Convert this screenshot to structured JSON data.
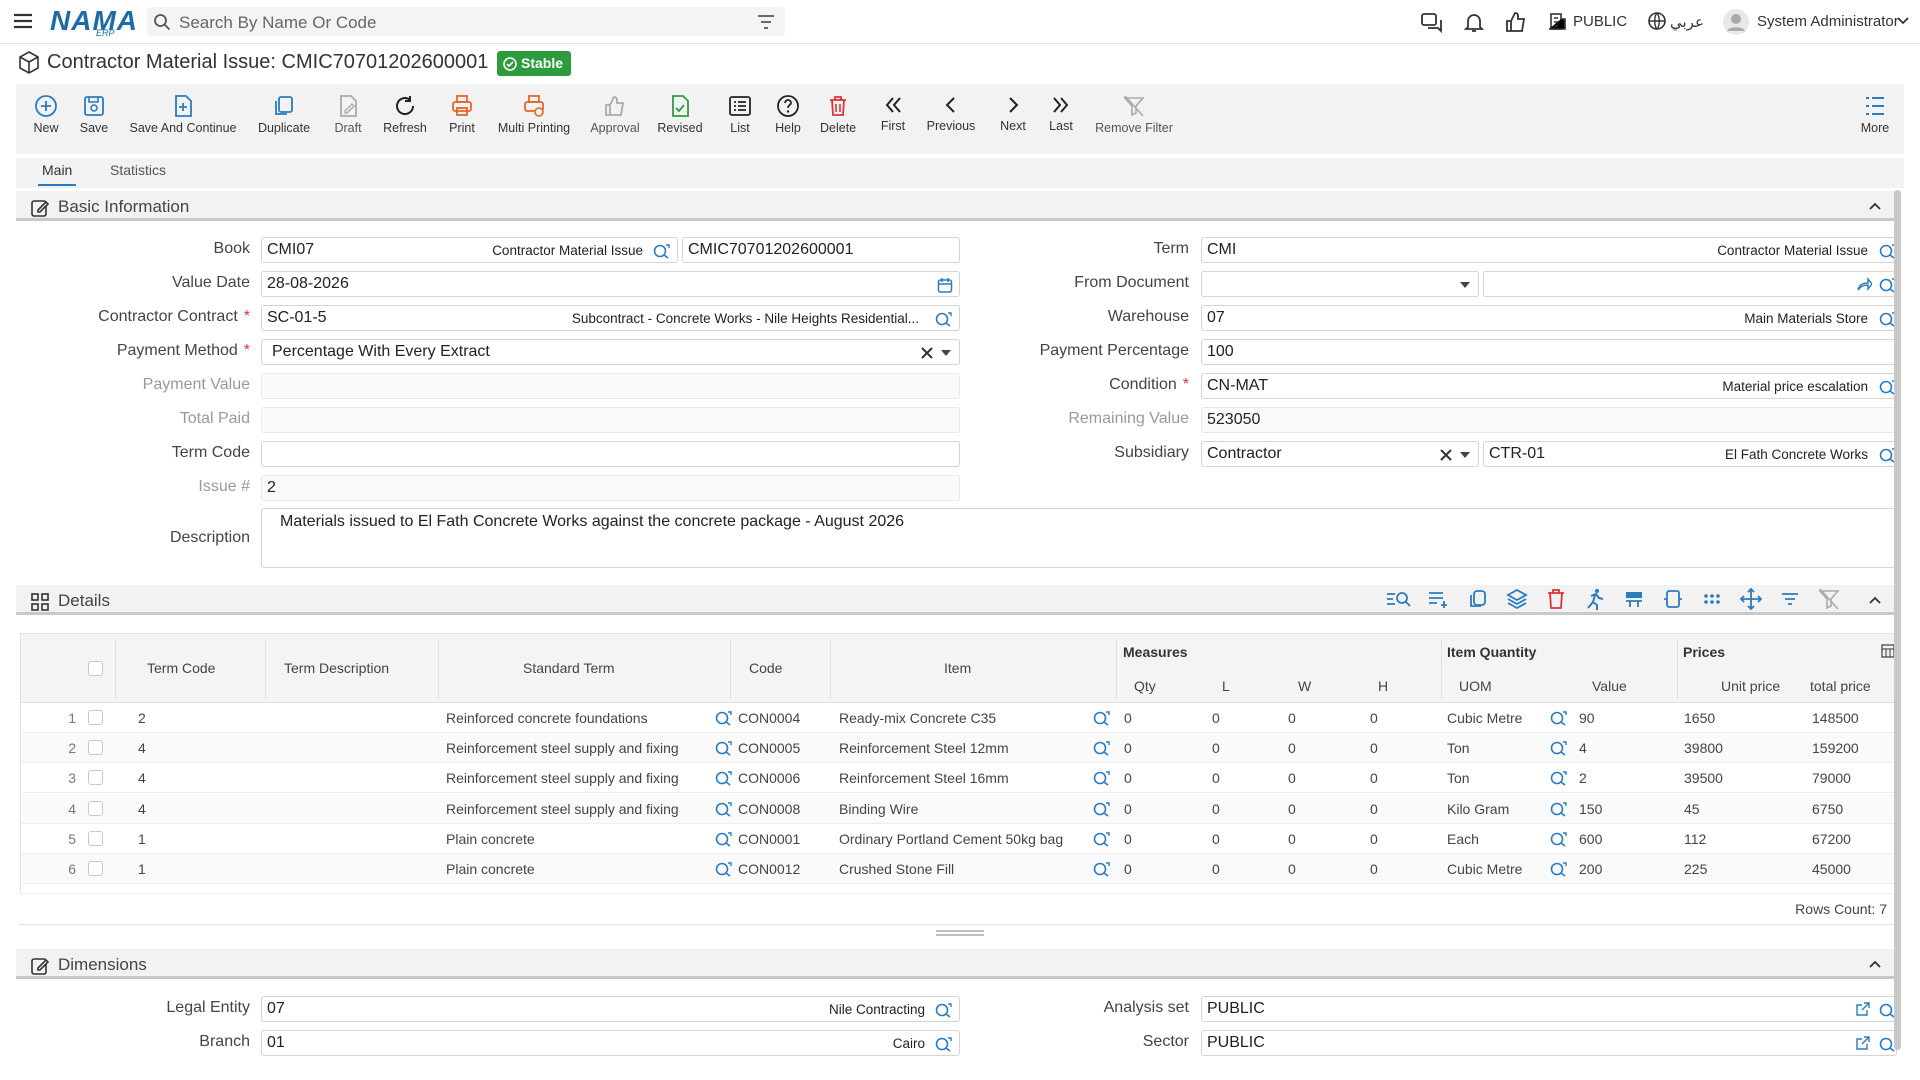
{
  "topbar": {
    "logo_text": "NAMA",
    "logo_sub": "ERP",
    "search_placeholder": "Search By Name Or Code",
    "company": "PUBLIC",
    "language": "عربي",
    "user": "System Administrator"
  },
  "page": {
    "title": "Contractor Material Issue: CMIC70701202600001",
    "status": "Stable"
  },
  "toolbar": {
    "new": "New",
    "save": "Save",
    "save_continue": "Save And Continue",
    "duplicate": "Duplicate",
    "draft": "Draft",
    "refresh": "Refresh",
    "print": "Print",
    "multi_printing": "Multi Printing",
    "approval": "Approval",
    "revised": "Revised",
    "list": "List",
    "help": "Help",
    "delete": "Delete",
    "first": "First",
    "previous": "Previous",
    "next": "Next",
    "last": "Last",
    "remove_filter": "Remove Filter",
    "more": "More"
  },
  "tabs": {
    "main": "Main",
    "statistics": "Statistics"
  },
  "basic": {
    "title": "Basic Information",
    "book_label": "Book",
    "book_code": "CMI07",
    "book_desc": "Contractor Material Issue",
    "book_number": "CMIC70701202600001",
    "value_date_label": "Value Date",
    "value_date": "28-08-2026",
    "contract_label": "Contractor Contract",
    "contract_code": "SC-01-5",
    "contract_desc": "Subcontract - Concrete Works - Nile Heights Residential...",
    "payment_method_label": "Payment Method",
    "payment_method": "Percentage With Every Extract",
    "payment_value_label": "Payment Value",
    "total_paid_label": "Total Paid",
    "term_code_label": "Term Code",
    "issue_label": "Issue #",
    "issue": "2",
    "term_label": "Term",
    "term_code": "CMI",
    "term_desc": "Contractor Material Issue",
    "from_doc_label": "From Document",
    "warehouse_label": "Warehouse",
    "warehouse_code": "07",
    "warehouse_desc": "Main Materials Store",
    "payment_pct_label": "Payment Percentage",
    "payment_pct": "100",
    "condition_label": "Condition",
    "condition_code": "CN-MAT",
    "condition_desc": "Material price escalation",
    "remaining_label": "Remaining Value",
    "remaining": "523050",
    "subsidiary_label": "Subsidiary",
    "subsidiary_type": "Contractor",
    "subsidiary_code": "CTR-01",
    "subsidiary_desc": "El Fath Concrete Works",
    "description_label": "Description",
    "description": "Materials issued to El Fath Concrete Works against the concrete package - August 2026"
  },
  "details": {
    "title": "Details",
    "headers": {
      "term_code": "Term Code",
      "term_desc": "Term Description",
      "standard_term": "Standard Term",
      "code": "Code",
      "item": "Item",
      "measures": "Measures",
      "qty": "Qty",
      "l": "L",
      "w": "W",
      "h": "H",
      "item_quantity": "Item Quantity",
      "uom": "UOM",
      "value": "Value",
      "prices": "Prices",
      "unit_price": "Unit price",
      "total_price": "total price"
    },
    "rows": [
      {
        "n": "1",
        "term_code": "2",
        "std": "Reinforced concrete foundations",
        "code": "CON0004",
        "item": "Ready-mix Concrete C35",
        "qty": "0",
        "l": "0",
        "w": "0",
        "h": "0",
        "uom": "Cubic Metre",
        "value": "90",
        "unit_price": "1650",
        "total": "148500"
      },
      {
        "n": "2",
        "term_code": "4",
        "std": "Reinforcement steel supply and fixing",
        "code": "CON0005",
        "item": "Reinforcement Steel 12mm",
        "qty": "0",
        "l": "0",
        "w": "0",
        "h": "0",
        "uom": "Ton",
        "value": "4",
        "unit_price": "39800",
        "total": "159200"
      },
      {
        "n": "3",
        "term_code": "4",
        "std": "Reinforcement steel supply and fixing",
        "code": "CON0006",
        "item": "Reinforcement Steel 16mm",
        "qty": "0",
        "l": "0",
        "w": "0",
        "h": "0",
        "uom": "Ton",
        "value": "2",
        "unit_price": "39500",
        "total": "79000"
      },
      {
        "n": "4",
        "term_code": "4",
        "std": "Reinforcement steel supply and fixing",
        "code": "CON0008",
        "item": "Binding Wire",
        "qty": "0",
        "l": "0",
        "w": "0",
        "h": "0",
        "uom": "Kilo Gram",
        "value": "150",
        "unit_price": "45",
        "total": "6750"
      },
      {
        "n": "5",
        "term_code": "1",
        "std": "Plain concrete",
        "code": "CON0001",
        "item": "Ordinary Portland Cement 50kg bag",
        "qty": "0",
        "l": "0",
        "w": "0",
        "h": "0",
        "uom": "Each",
        "value": "600",
        "unit_price": "112",
        "total": "67200"
      },
      {
        "n": "6",
        "term_code": "1",
        "std": "Plain concrete",
        "code": "CON0012",
        "item": "Crushed Stone Fill",
        "qty": "0",
        "l": "0",
        "w": "0",
        "h": "0",
        "uom": "Cubic Metre",
        "value": "200",
        "unit_price": "225",
        "total": "45000"
      }
    ],
    "rows_count": "Rows Count: 7"
  },
  "dimensions": {
    "title": "Dimensions",
    "legal_entity_label": "Legal Entity",
    "legal_entity_code": "07",
    "legal_entity_desc": "Nile Contracting",
    "branch_label": "Branch",
    "branch_code": "01",
    "branch_desc": "Cairo",
    "analysis_set_label": "Analysis set",
    "analysis_set": "PUBLIC",
    "sector_label": "Sector",
    "sector": "PUBLIC"
  },
  "colors": {
    "accent": "#2b7bbf",
    "stable": "#2e9b3e",
    "danger": "#d33"
  }
}
